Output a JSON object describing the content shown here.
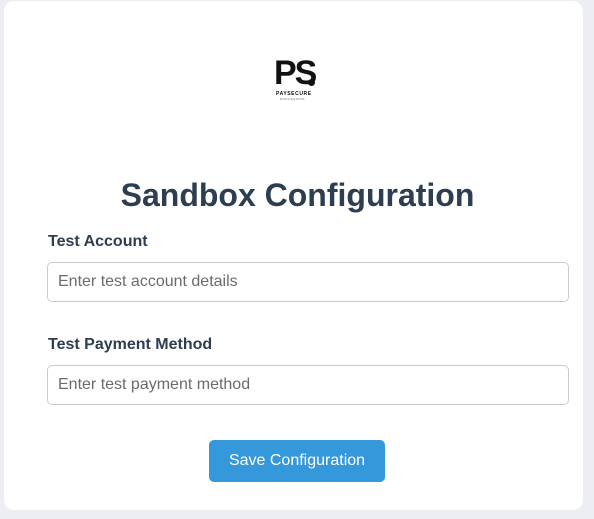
{
  "logo": {
    "mark": "PS",
    "name": "PAYSECURE",
    "tagline": "PROCESSING"
  },
  "page": {
    "title": "Sandbox Configuration"
  },
  "form": {
    "test_account": {
      "label": "Test Account",
      "value": "",
      "placeholder": "Enter test account details"
    },
    "test_payment_method": {
      "label": "Test Payment Method",
      "value": "",
      "placeholder": "Enter test payment method"
    },
    "save_label": "Save Configuration"
  },
  "colors": {
    "background": "#eceef3",
    "card": "#ffffff",
    "heading": "#2c3e50",
    "accent": "#3498db"
  }
}
